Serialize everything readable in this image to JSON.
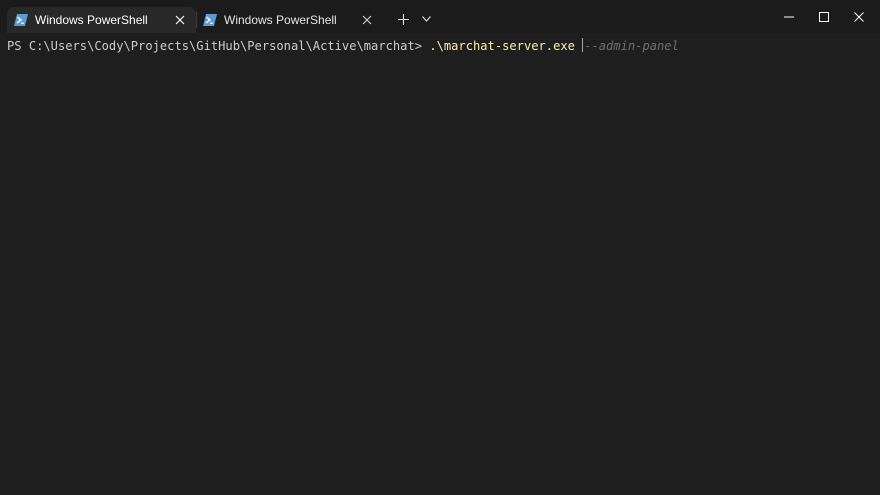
{
  "tabs": [
    {
      "label": "Windows PowerShell",
      "icon": "powershell-icon",
      "active": true
    },
    {
      "label": "Windows PowerShell",
      "icon": "powershell-icon",
      "active": false
    }
  ],
  "terminal": {
    "prompt": "PS C:\\Users\\Cody\\Projects\\GitHub\\Personal\\Active\\marchat>",
    "command": ".\\marchat-server.exe",
    "suggestion": "--admin-panel"
  },
  "colors": {
    "background": "#1e1e1e",
    "titlebar": "#1b1b1b",
    "active_tab": "#282828",
    "command": "#f9f1a5",
    "suggestion": "#6e6e6e",
    "powershell_icon": "#5b9bd5"
  }
}
